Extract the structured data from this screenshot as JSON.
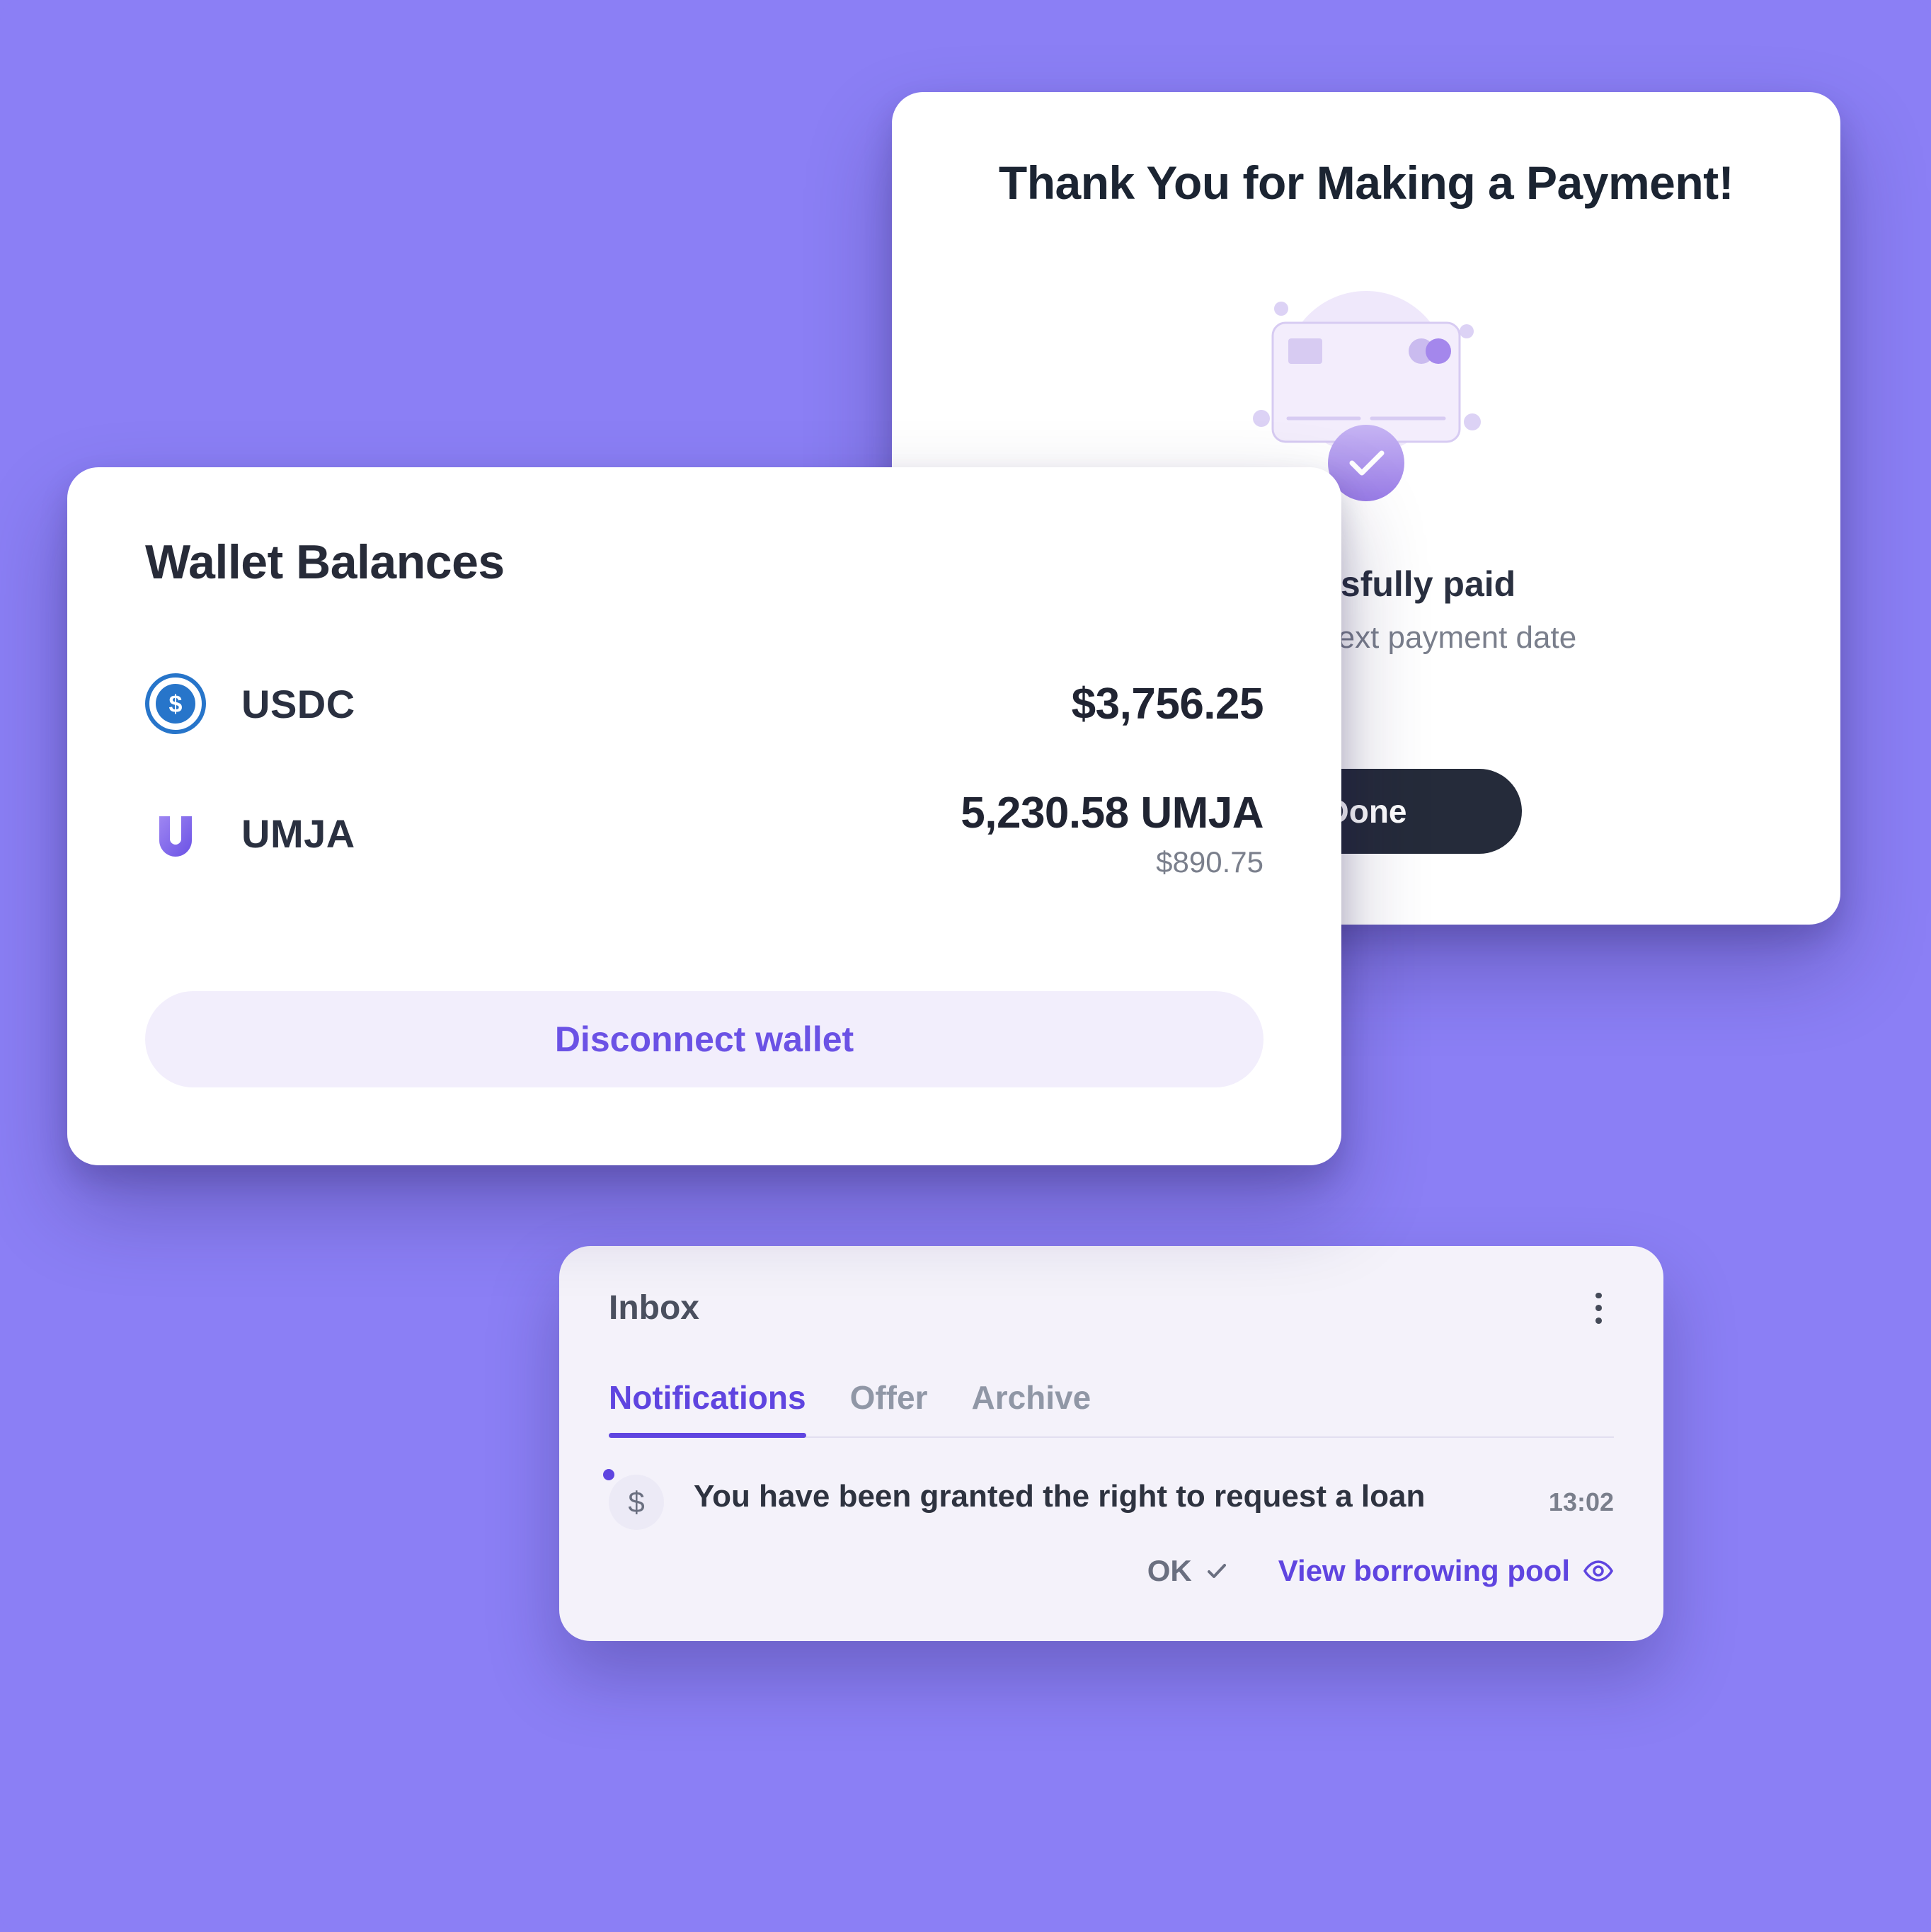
{
  "payment": {
    "title": "Thank You for Making a Payment!",
    "status_title": "Successfully paid",
    "status_sub": "atch for the next payment date",
    "done_label": "Done"
  },
  "wallet": {
    "title": "Wallet Balances",
    "balances": [
      {
        "symbol": "USDC",
        "primary": "$3,756.25",
        "secondary": ""
      },
      {
        "symbol": "UMJA",
        "primary": "5,230.58 UMJA",
        "secondary": "$890.75"
      }
    ],
    "disconnect_label": "Disconnect wallet"
  },
  "inbox": {
    "title": "Inbox",
    "tabs": [
      "Notifications",
      "Offer",
      "Archive"
    ],
    "active_tab": 0,
    "notification": {
      "text": "You have been granted the right to request a loan",
      "time": "13:02",
      "ok_label": "OK",
      "view_label": "View borrowing pool"
    }
  },
  "colors": {
    "bg": "#8b7ff5",
    "accent": "#5f45e0",
    "dark": "#252b3a"
  }
}
